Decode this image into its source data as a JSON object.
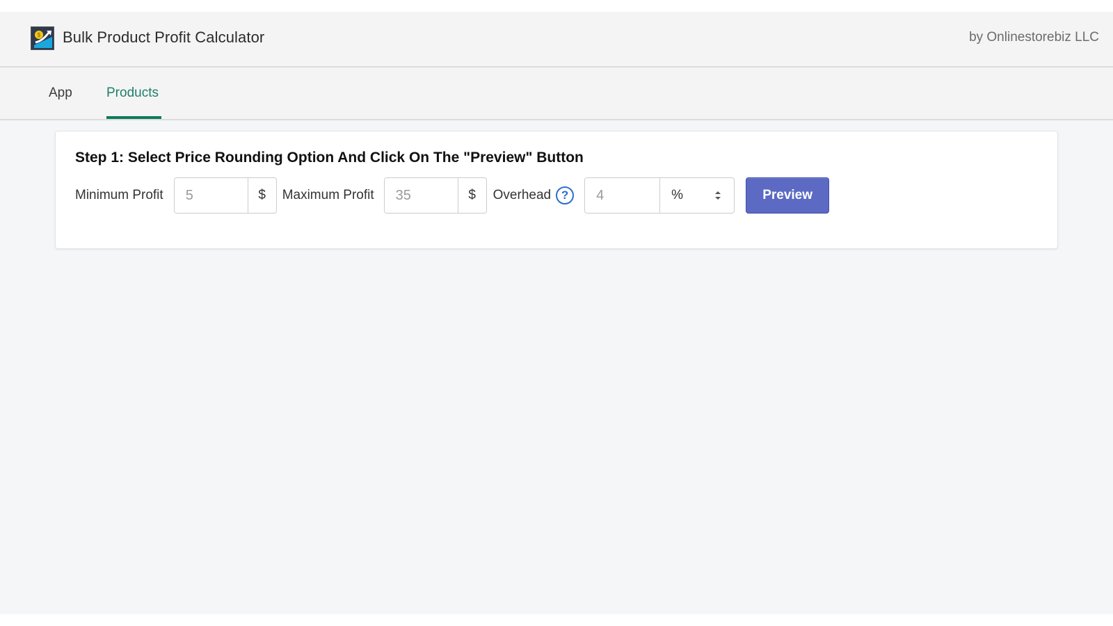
{
  "header": {
    "app_title": "Bulk Product Profit Calculator",
    "by_line": "by Onlinestorebiz LLC",
    "logo_icon": "profit-growth-logo-icon"
  },
  "tabs": [
    {
      "label": "App",
      "active": false
    },
    {
      "label": "Products",
      "active": true
    }
  ],
  "step1": {
    "title": "Step 1: Select Price Rounding Option And Click On The \"Preview\" Button",
    "min_profit": {
      "label": "Minimum Profit",
      "value": "5",
      "unit": "$"
    },
    "max_profit": {
      "label": "Maximum Profit",
      "value": "35",
      "unit": "$"
    },
    "overhead": {
      "label": "Overhead",
      "help_icon": "?",
      "value": "4",
      "unit_selected": "%"
    },
    "preview_label": "Preview"
  },
  "colors": {
    "accent_tab": "#0e7a5a",
    "primary_button": "#5c6ac4",
    "help_icon": "#2c6ecb"
  }
}
